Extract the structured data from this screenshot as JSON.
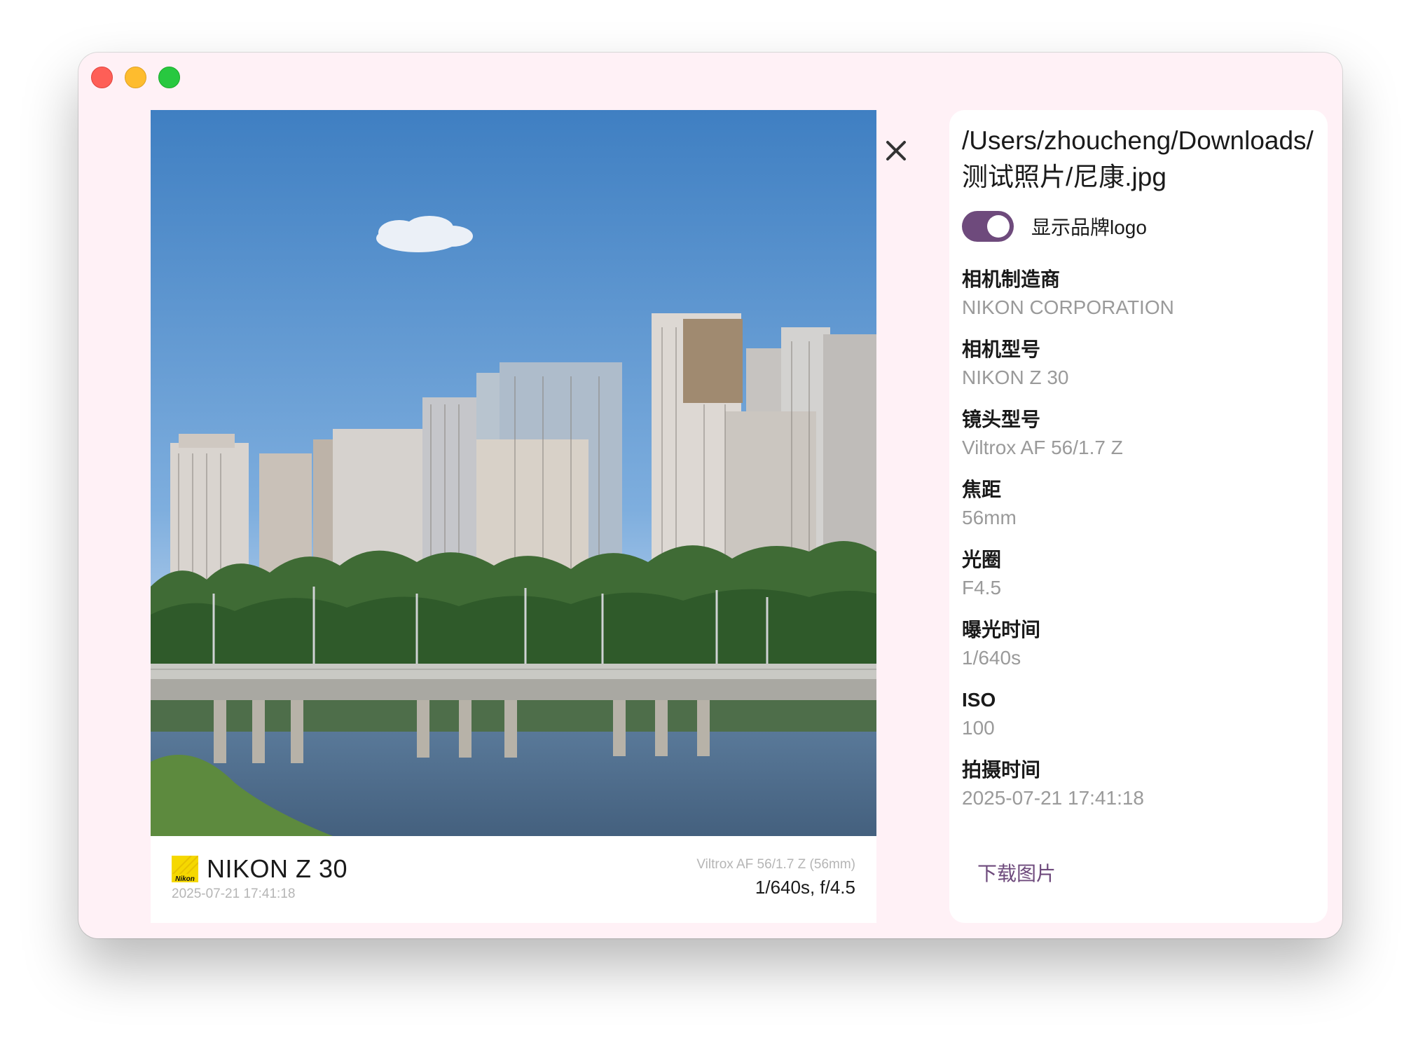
{
  "window": {
    "traffic_lights": [
      "close",
      "minimize",
      "zoom"
    ]
  },
  "photo": {
    "caption": {
      "brand_logo_text": "Nikon",
      "model": "NIKON Z 30",
      "datetime": "2025-07-21 17:41:18",
      "lens": "Viltrox AF 56/1.7 Z (56mm)",
      "exposure": "1/640s, f/4.5"
    }
  },
  "close_icon": "close-icon",
  "panel": {
    "path": "/Users/zhoucheng/Downloads/测试照片/尼康.jpg",
    "toggle": {
      "label": "显示品牌logo",
      "on": true
    },
    "fields": [
      {
        "label": "相机制造商",
        "value": "NIKON CORPORATION"
      },
      {
        "label": "相机型号",
        "value": "NIKON Z 30"
      },
      {
        "label": "镜头型号",
        "value": "Viltrox AF 56/1.7 Z"
      },
      {
        "label": "焦距",
        "value": "56mm"
      },
      {
        "label": "光圈",
        "value": "F4.5"
      },
      {
        "label": "曝光时间",
        "value": "1/640s"
      },
      {
        "label": "ISO",
        "value": "100"
      },
      {
        "label": "拍摄时间",
        "value": "2025-07-21 17:41:18"
      }
    ],
    "download_label": "下载图片"
  },
  "colors": {
    "window_bg": "#fff1f6",
    "accent": "#6e4a7c",
    "muted_text": "#9a9a9a"
  }
}
